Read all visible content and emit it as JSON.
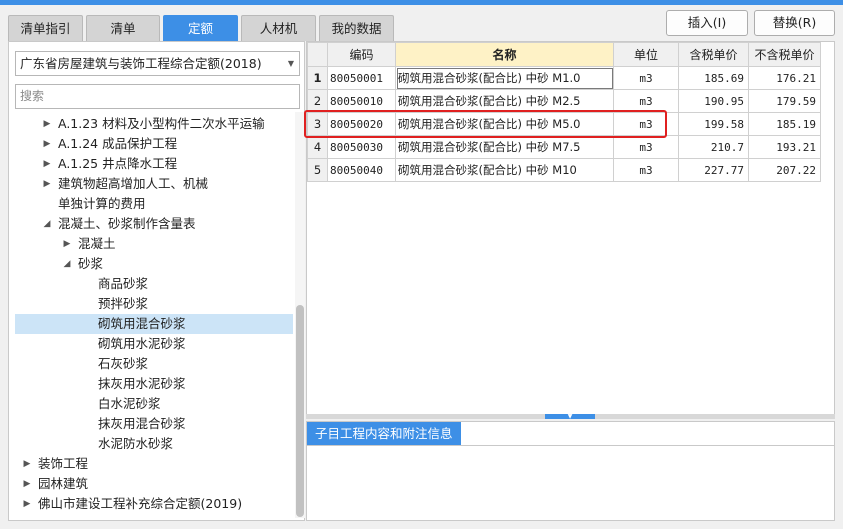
{
  "tabs": [
    "清单指引",
    "清单",
    "定额",
    "人材机",
    "我的数据"
  ],
  "active_tab": 2,
  "buttons": {
    "insert": "插入(I)",
    "replace": "替换(R)"
  },
  "left_panel": {
    "library": "广东省房屋建筑与装饰工程综合定额(2018)",
    "search_placeholder": "搜索",
    "tree": [
      {
        "label": "A.1.23 材料及小型构件二次水平运输",
        "level": 1,
        "toggle": "collapsed"
      },
      {
        "label": "A.1.24 成品保护工程",
        "level": 1,
        "toggle": "collapsed"
      },
      {
        "label": "A.1.25 井点降水工程",
        "level": 1,
        "toggle": "collapsed"
      },
      {
        "label": "建筑物超高增加人工、机械",
        "level": 1,
        "toggle": "collapsed"
      },
      {
        "label": "单独计算的费用",
        "level": 1,
        "toggle": "none"
      },
      {
        "label": "混凝土、砂浆制作含量表",
        "level": 1,
        "toggle": "expanded"
      },
      {
        "label": "混凝土",
        "level": 2,
        "toggle": "collapsed"
      },
      {
        "label": "砂浆",
        "level": 2,
        "toggle": "expanded"
      },
      {
        "label": "商品砂浆",
        "level": 3,
        "toggle": "none"
      },
      {
        "label": "预拌砂浆",
        "level": 3,
        "toggle": "none"
      },
      {
        "label": "砌筑用混合砂浆",
        "level": 3,
        "toggle": "none",
        "selected": true
      },
      {
        "label": "砌筑用水泥砂浆",
        "level": 3,
        "toggle": "none"
      },
      {
        "label": "石灰砂浆",
        "level": 3,
        "toggle": "none"
      },
      {
        "label": "抹灰用水泥砂浆",
        "level": 3,
        "toggle": "none"
      },
      {
        "label": "白水泥砂浆",
        "level": 3,
        "toggle": "none"
      },
      {
        "label": "抹灰用混合砂浆",
        "level": 3,
        "toggle": "none"
      },
      {
        "label": "水泥防水砂浆",
        "level": 3,
        "toggle": "none"
      },
      {
        "label": "装饰工程",
        "level": 0,
        "toggle": "collapsed"
      },
      {
        "label": "园林建筑",
        "level": 0,
        "toggle": "collapsed"
      },
      {
        "label": "佛山市建设工程补充综合定额(2019)",
        "level": 0,
        "toggle": "collapsed"
      }
    ]
  },
  "table": {
    "columns": [
      "编码",
      "名称",
      "单位",
      "含税单价",
      "不含税单价"
    ],
    "rows": [
      {
        "no": "1",
        "code": "80050001",
        "name": "砌筑用混合砂浆(配合比) 中砂 M1.0",
        "unit": "m3",
        "tax_price": "185.69",
        "notax_price": "176.21"
      },
      {
        "no": "2",
        "code": "80050010",
        "name": "砌筑用混合砂浆(配合比) 中砂 M2.5",
        "unit": "m3",
        "tax_price": "190.95",
        "notax_price": "179.59"
      },
      {
        "no": "3",
        "code": "80050020",
        "name": "砌筑用混合砂浆(配合比) 中砂 M5.0",
        "unit": "m3",
        "tax_price": "199.58",
        "notax_price": "185.19"
      },
      {
        "no": "4",
        "code": "80050030",
        "name": "砌筑用混合砂浆(配合比) 中砂 M7.5",
        "unit": "m3",
        "tax_price": "210.7",
        "notax_price": "193.21"
      },
      {
        "no": "5",
        "code": "80050040",
        "name": "砌筑用混合砂浆(配合比) 中砂 M10",
        "unit": "m3",
        "tax_price": "227.77",
        "notax_price": "207.22"
      }
    ]
  },
  "bottom_panel": {
    "tab": "子目工程内容和附注信息"
  },
  "colors": {
    "accent": "#3d8fe6",
    "highlight_border": "#e02020",
    "selected_row": "#cce4f7"
  }
}
